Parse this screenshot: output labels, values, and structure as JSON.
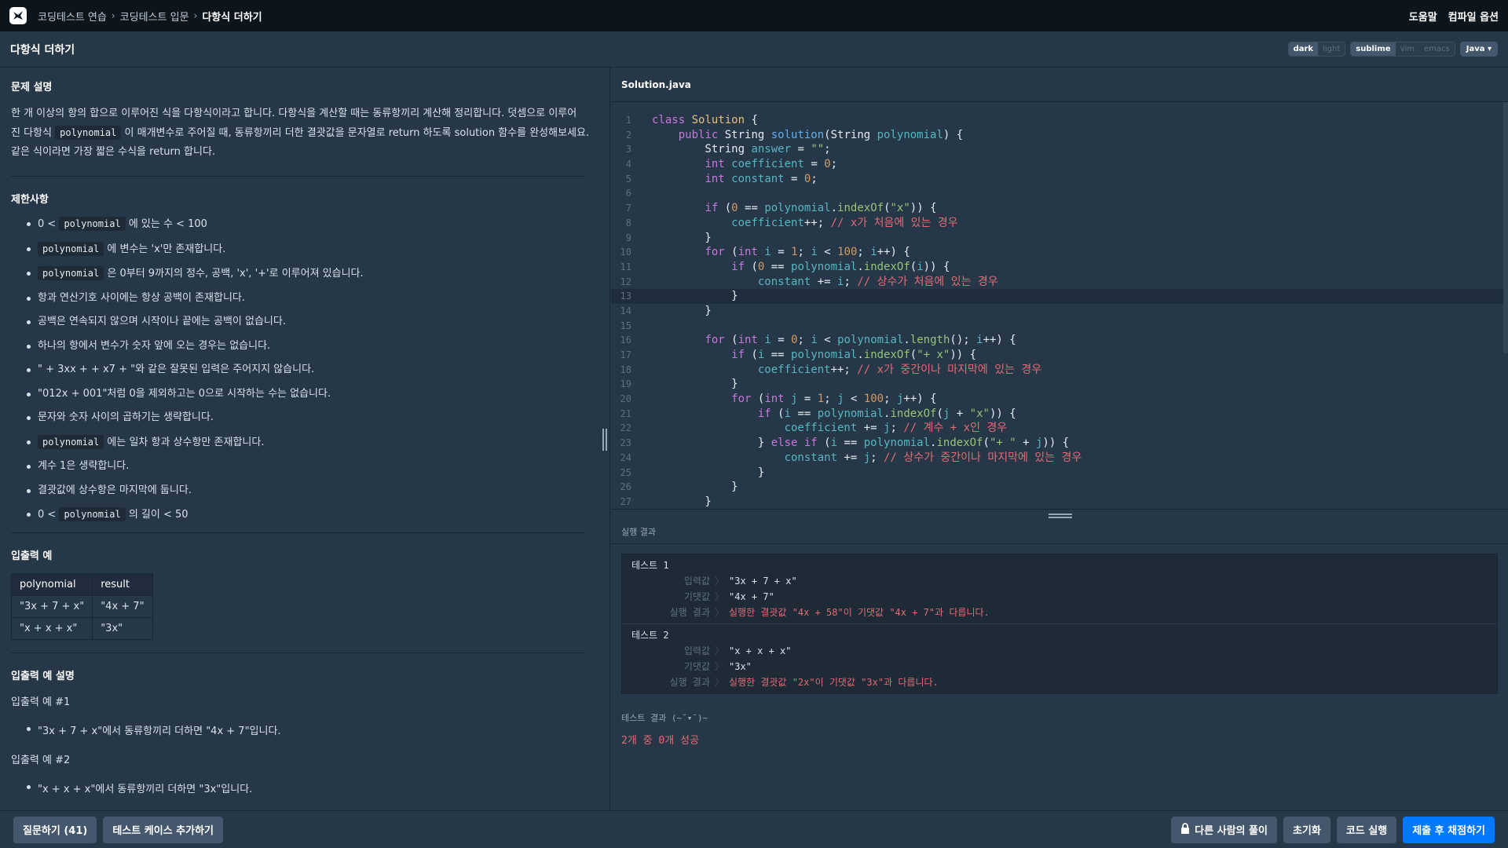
{
  "nav": {
    "breadcrumb": [
      "코딩테스트 연습",
      "코딩테스트 입문",
      "다항식 더하기"
    ],
    "help": "도움말",
    "compile_options": "컴파일 옵션"
  },
  "title": "다항식 더하기",
  "toggles": {
    "theme": [
      "dark",
      "light"
    ],
    "keymap": [
      "sublime",
      "vim",
      "emacs"
    ],
    "language": "Java"
  },
  "problem": {
    "heading": "문제 설명",
    "desc_1": "한 개 이상의 항의 합으로 이루어진 식을 다항식이라고 합니다. 다항식을 계산할 때는 동류항끼리 계산해 정리합니다. 덧셈으로 이루어",
    "desc_2a": "진 다항식",
    "desc_code": "polynomial",
    "desc_2b": "이 매개변수로 주어질 때, 동류항끼리 더한 결괏값을 문자열로 return 하도록 solution 함수를 완성해보세요.",
    "desc_3": "같은 식이라면 가장 짧은 수식을 return 합니다."
  },
  "constraints": {
    "heading": "제한사항",
    "code": "polynomial",
    "c1_a": "0 <",
    "c1_b": "에 있는 수 < 100",
    "c2": "에 변수는 'x'만 존재합니다.",
    "c3": "은 0부터 9까지의 정수, 공백, 'x', '+'로 이루어져 있습니다.",
    "c4": "항과 연산기호 사이에는 항상 공백이 존재합니다.",
    "c5": "공백은 연속되지 않으며 시작이나 끝에는 공백이 없습니다.",
    "c6": "하나의 항에서 변수가 숫자 앞에 오는 경우는 없습니다.",
    "c7": "\" + 3xx + + x7 + \"와 같은 잘못된 입력은 주어지지 않습니다.",
    "c8": "\"012x + 001\"처럼 0을 제외하고는 0으로 시작하는 수는 없습니다.",
    "c9": "문자와 숫자 사이의 곱하기는 생략합니다.",
    "c10": "에는 일차 항과 상수항만 존재합니다.",
    "c11": "계수 1은 생략합니다.",
    "c12": "결괏값에 상수항은 마지막에 둡니다.",
    "c13_a": "0 <",
    "c13_b": "의 길이 < 50"
  },
  "io": {
    "heading": "입출력 예",
    "headers": [
      "polynomial",
      "result"
    ],
    "rows": [
      [
        "\"3x + 7 + x\"",
        "\"4x + 7\""
      ],
      [
        "\"x + x + x\"",
        "\"3x\""
      ]
    ]
  },
  "io_explain": {
    "heading": "입출력 예 설명",
    "ex1_label": "입출력 예 #1",
    "ex1_text": "\"3x + 7 + x\"에서 동류항끼리 더하면 \"4x + 7\"입니다.",
    "ex2_label": "입출력 예 #2",
    "ex2_text": "\"x + x + x\"에서 동류항끼리 더하면 \"3x\"입니다."
  },
  "editor": {
    "filename": "Solution.java",
    "active_line": 13
  },
  "results": {
    "heading": "실행 결과",
    "labels": {
      "input": "입력값",
      "expected": "기댓값",
      "result": "실행 결과"
    },
    "tests": [
      {
        "name": "테스트 1",
        "input": "\"3x + 7 + x\"",
        "expected": "\"4x + 7\"",
        "result": "실행한 결괏값 \"4x + 58\"이 기댓값 \"4x + 7\"과 다릅니다."
      },
      {
        "name": "테스트 2",
        "input": "\"x + x + x\"",
        "expected": "\"3x\"",
        "result": "실행한 결괏값 \"2x\"이 기댓값 \"3x\"과 다릅니다."
      }
    ],
    "summary_title": "테스트 결과 (~˘▾˘)~",
    "summary": "2개 중 0개 성공"
  },
  "bottom": {
    "ask": "질문하기 (41)",
    "add_testcase": "테스트 케이스 추가하기",
    "others": "다른 사람의 풀이",
    "reset": "초기화",
    "run": "코드 실행",
    "submit": "제출 후 채점하기"
  },
  "colors": {
    "accent": "#0078ff",
    "error": "#e06c75",
    "bg": "#263747",
    "topbar": "#0c151c"
  }
}
